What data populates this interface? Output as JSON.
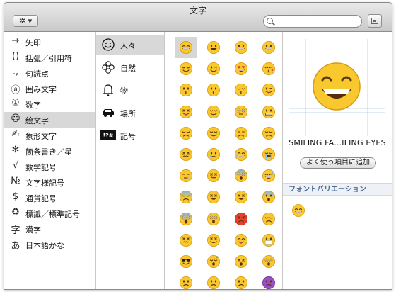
{
  "window": {
    "title": "文字"
  },
  "toolbar": {
    "gear_label": "✲ ▾",
    "search_placeholder": "",
    "search_value": ""
  },
  "categories": [
    {
      "glyph": "→",
      "label": "矢印",
      "icon": "arrow-icon"
    },
    {
      "glyph": "()",
      "label": "括弧／引用符",
      "icon": "parentheses-icon"
    },
    {
      "glyph": ".,",
      "label": "句読点",
      "icon": "punctuation-icon"
    },
    {
      "glyph": "ⓐ",
      "label": "囲み文字",
      "icon": "enclosed-letter-icon"
    },
    {
      "glyph": "①",
      "label": "数字",
      "icon": "circled-number-icon"
    },
    {
      "glyph": "☺",
      "label": "絵文字",
      "icon": "smiley-icon"
    },
    {
      "glyph": "✍",
      "label": "象形文字",
      "icon": "writing-hand-icon"
    },
    {
      "glyph": "✻",
      "label": "箇条書き／星",
      "icon": "asterisk-icon"
    },
    {
      "glyph": "√",
      "label": "数学記号",
      "icon": "square-root-icon"
    },
    {
      "glyph": "№",
      "label": "文字様記号",
      "icon": "numero-icon"
    },
    {
      "glyph": "$",
      "label": "通貨記号",
      "icon": "dollar-icon"
    },
    {
      "glyph": "♻",
      "label": "標識／標準記号",
      "icon": "recycle-icon"
    },
    {
      "glyph": "字",
      "label": "漢字",
      "icon": "kanji-icon"
    },
    {
      "glyph": "あ",
      "label": "日本語かな",
      "icon": "kana-icon"
    }
  ],
  "subcategories": [
    {
      "label": "人々",
      "icon": "face-icon"
    },
    {
      "label": "自然",
      "icon": "flower-icon"
    },
    {
      "label": "物",
      "icon": "bell-icon"
    },
    {
      "label": "場所",
      "icon": "car-icon"
    },
    {
      "label": "記号",
      "icon": "symbols-icon"
    }
  ],
  "emoji_grid": [
    [
      "grin",
      "smile-open",
      "smile-big",
      "smile-big"
    ],
    [
      "blush",
      "wink",
      "heart-eyes",
      "kiss-heart"
    ],
    [
      "kiss",
      "kiss-plain",
      "kiss-closed",
      "tongue-wink"
    ],
    [
      "tongue-closed",
      "relieved",
      "flushed",
      "grimace"
    ],
    [
      "pensive",
      "relieved",
      "unamused",
      "disappointed"
    ],
    [
      "persevere",
      "cry",
      "joy",
      "sob"
    ],
    [
      "sleepy",
      "confounded",
      "fearful",
      "grin-sweat"
    ],
    [
      "sweat",
      "weary",
      "tired",
      "cold-sweat"
    ],
    [
      "scream",
      "astonished",
      "angry",
      "triumph"
    ],
    [
      "confounded",
      "laugh",
      "yum",
      "mask"
    ],
    [
      "sunglasses",
      "sleeping",
      "dizzy",
      "surprised"
    ],
    [
      "frown",
      "frown",
      "frown",
      "imp"
    ]
  ],
  "detail": {
    "char_name": "SMILING FA...ILING EYES",
    "add_favorite": "よく使う項目に追加",
    "variation_header": "フォントバリエーション"
  },
  "colors": {
    "selection": "#d8d8d8",
    "accent": "#4a6a92",
    "emoji_yellow": "#f9c72e",
    "emoji_edge": "#d99a0b"
  }
}
